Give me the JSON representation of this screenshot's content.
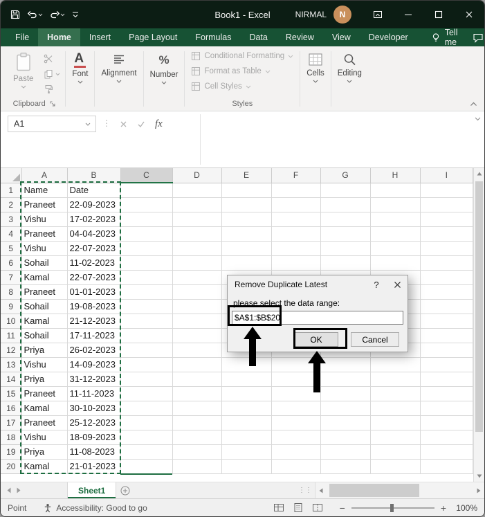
{
  "titlebar": {
    "title": "Book1 - Excel",
    "user": "NIRMAL",
    "avatar_initial": "N"
  },
  "ribbon_tabs": {
    "items": [
      "File",
      "Home",
      "Insert",
      "Page Layout",
      "Formulas",
      "Data",
      "Review",
      "View",
      "Developer"
    ],
    "active": "Home",
    "tell_me_label": "Tell me"
  },
  "ribbon": {
    "paste_label": "Paste",
    "clipboard_group_label": "Clipboard",
    "font_label": "Font",
    "alignment_label": "Alignment",
    "number_label": "Number",
    "styles_items": [
      "Conditional Formatting",
      "Format as Table",
      "Cell Styles"
    ],
    "styles_group_label": "Styles",
    "cells_label": "Cells",
    "editing_label": "Editing"
  },
  "formula_bar": {
    "name_box_value": "A1",
    "fx_label": "fx",
    "formula_value": ""
  },
  "grid": {
    "column_headers": [
      "A",
      "B",
      "C",
      "D",
      "E",
      "F",
      "G",
      "H",
      "I"
    ],
    "active_column": "C",
    "selected_range": "A1:B20",
    "rows": [
      [
        1,
        "Name",
        "Date"
      ],
      [
        2,
        "Praneet",
        "22-09-2023"
      ],
      [
        3,
        "Vishu",
        "17-02-2023"
      ],
      [
        4,
        "Praneet",
        "04-04-2023"
      ],
      [
        5,
        "Vishu",
        "22-07-2023"
      ],
      [
        6,
        "Sohail",
        "11-02-2023"
      ],
      [
        7,
        "Kamal",
        "22-07-2023"
      ],
      [
        8,
        "Praneet",
        "01-01-2023"
      ],
      [
        9,
        "Sohail",
        "19-08-2023"
      ],
      [
        10,
        "Kamal",
        "21-12-2023"
      ],
      [
        11,
        "Sohail",
        "17-11-2023"
      ],
      [
        12,
        "Priya",
        "26-02-2023"
      ],
      [
        13,
        "Vishu",
        "14-09-2023"
      ],
      [
        14,
        "Priya",
        "31-12-2023"
      ],
      [
        15,
        "Praneet",
        "11-11-2023"
      ],
      [
        16,
        "Kamal",
        "30-10-2023"
      ],
      [
        17,
        "Praneet",
        "25-12-2023"
      ],
      [
        18,
        "Vishu",
        "18-09-2023"
      ],
      [
        19,
        "Priya",
        "11-08-2023"
      ],
      [
        20,
        "Kamal",
        "21-01-2023"
      ]
    ]
  },
  "dialog": {
    "title": "Remove Duplicate Latest",
    "help_label": "?",
    "prompt_label": "please select the data range:",
    "range_value": "$A$1:$B$20",
    "ok_label": "OK",
    "cancel_label": "Cancel"
  },
  "sheet_bar": {
    "active_sheet": "Sheet1"
  },
  "status_bar": {
    "mode": "Point",
    "accessibility": "Accessibility: Good to go",
    "zoom_level": "100%"
  },
  "colors": {
    "excel_green": "#217346",
    "selection_border": "#1e6e41",
    "titlebar": "#0c1d14"
  }
}
